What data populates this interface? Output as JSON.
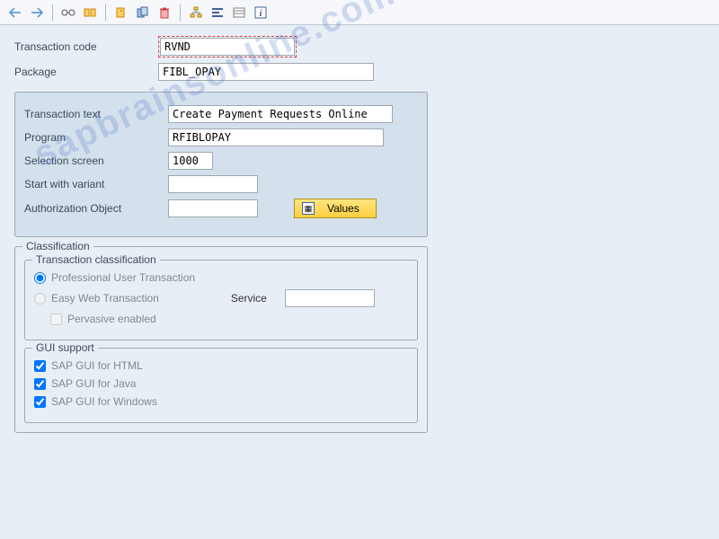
{
  "header": {
    "transaction_code_label": "Transaction code",
    "transaction_code_value": "RVND",
    "package_label": "Package",
    "package_value": "FIBL_OPAY"
  },
  "details": {
    "transaction_text_label": "Transaction text",
    "transaction_text_value": "Create Payment Requests Online",
    "program_label": "Program",
    "program_value": "RFIBLOPAY",
    "selection_screen_label": "Selection screen",
    "selection_screen_value": "1000",
    "start_with_variant_label": "Start with variant",
    "start_with_variant_value": "",
    "auth_object_label": "Authorization Object",
    "auth_object_value": "",
    "values_button": "Values"
  },
  "classification": {
    "title": "Classification",
    "transaction_class_title": "Transaction classification",
    "professional_label": "Professional User Transaction",
    "easy_web_label": "Easy Web Transaction",
    "service_label": "Service",
    "service_value": "",
    "pervasive_label": "Pervasive enabled",
    "gui_support_title": "GUI support",
    "gui_html": "SAP GUI for HTML",
    "gui_java": "SAP GUI for Java",
    "gui_windows": "SAP GUI for Windows"
  },
  "watermark": "sapbrainsonline.com"
}
